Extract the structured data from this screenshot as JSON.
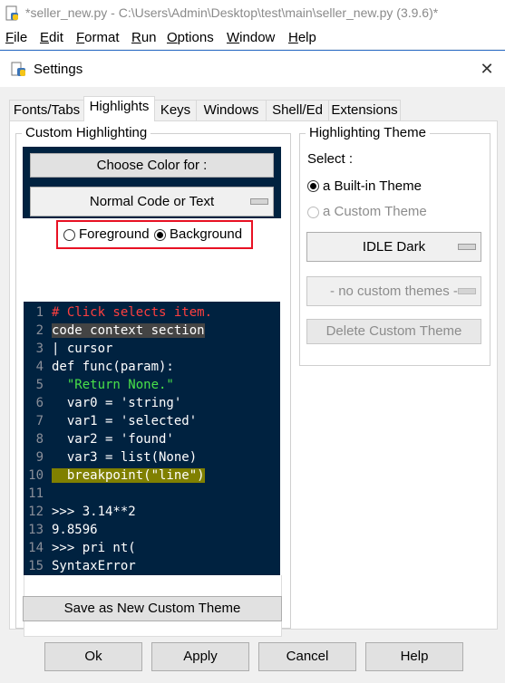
{
  "app": {
    "title": "*seller_new.py - C:\\Users\\Admin\\Desktop\\test\\main\\seller_new.py (3.9.6)*",
    "menu": [
      {
        "label": "File",
        "u": "F",
        "rest": "ile"
      },
      {
        "label": "Edit",
        "u": "E",
        "rest": "dit"
      },
      {
        "label": "Format",
        "u": "F",
        "rest": "ormat"
      },
      {
        "label": "Run",
        "u": "R",
        "rest": "un"
      },
      {
        "label": "Options",
        "u": "O",
        "rest": "ptions"
      },
      {
        "label": "Window",
        "u": "W",
        "rest": "indow"
      },
      {
        "label": "Help",
        "u": "H",
        "rest": "elp"
      }
    ]
  },
  "dialog": {
    "title": "Settings",
    "close_glyph": "✕",
    "tabs": [
      "Fonts/Tabs",
      "Highlights",
      "Keys",
      "Windows",
      "Shell/Ed",
      "Extensions"
    ],
    "active_tab": "Highlights"
  },
  "custom": {
    "group_label": "Custom Highlighting",
    "choose_color": "Choose Color for :",
    "element": "Normal Code or Text",
    "foreground": "Foreground",
    "background": "Background",
    "selected_radio": "Background",
    "save_theme": "Save as New Custom Theme"
  },
  "theme": {
    "group_label": "Highlighting Theme",
    "select_label": "Select :",
    "builtin": "a Built-in Theme",
    "custom": "a Custom Theme",
    "builtin_name": "IDLE Dark",
    "custom_name": "- no custom themes -",
    "delete": "Delete Custom Theme"
  },
  "sample": {
    "line_numbers": [
      "1",
      "2",
      "3",
      "4",
      "5",
      "6",
      "7",
      "8",
      "9",
      "10",
      "11",
      "12",
      "13",
      "14",
      "15"
    ],
    "lines": [
      "# Click selects item.",
      "code context section",
      "| cursor",
      "def func(param):",
      "  \"Return None.\"",
      "  var0 = 'string'",
      "  var1 = 'selected'",
      "  var2 = 'found'",
      "  var3 = list(None)",
      "  breakpoint(\"line\")",
      "",
      ">>> 3.14**2",
      "9.8596",
      ">>> pri nt(",
      "SyntaxError"
    ]
  },
  "footer": {
    "ok": "Ok",
    "apply": "Apply",
    "cancel": "Cancel",
    "help": "Help"
  },
  "colors": {
    "sample_bg": "#002240",
    "highlight_box": "#e81123",
    "accent": "#2b6cc4"
  }
}
